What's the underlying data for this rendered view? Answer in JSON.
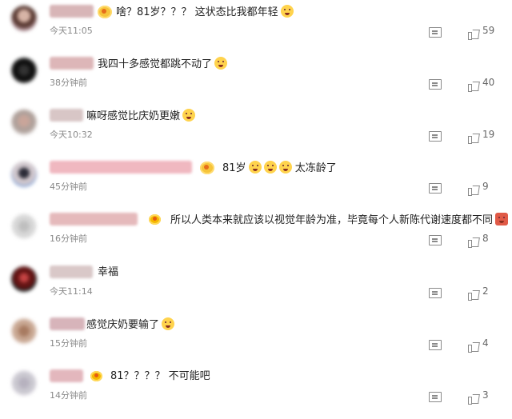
{
  "comments": [
    {
      "text": "啥？81岁？？？ 这状态比我都年轻",
      "emoji": true,
      "time": "今天11:05",
      "likes": "59"
    },
    {
      "text": "我四十多感觉都跳不动了",
      "emoji": true,
      "time": "38分钟前",
      "likes": "40"
    },
    {
      "text": "嘛呀感觉比庆奶更嫩",
      "emoji": true,
      "time": "今天10:32",
      "likes": "19"
    },
    {
      "text": "81岁",
      "emoji": true,
      "time": "45分钟前",
      "likes": "9",
      "extra": "太冻龄了"
    },
    {
      "text": "所以人类本来就应该以视觉年龄为准，毕竟每个人新陈代谢速度都不同",
      "emoji": true,
      "time": "16分钟前",
      "likes": "8"
    },
    {
      "text": "幸福",
      "emoji": false,
      "time": "今天11:14",
      "likes": "2"
    },
    {
      "text": "感觉庆奶要输了",
      "emoji": true,
      "time": "15分钟前",
      "likes": "4"
    },
    {
      "text": "81？？？？ 不可能吧",
      "emoji": false,
      "time": "14分钟前",
      "likes": "3"
    }
  ],
  "icons": [
    "comment-icon",
    "like-icon",
    "emoji-icon",
    "vip-badge-icon"
  ]
}
